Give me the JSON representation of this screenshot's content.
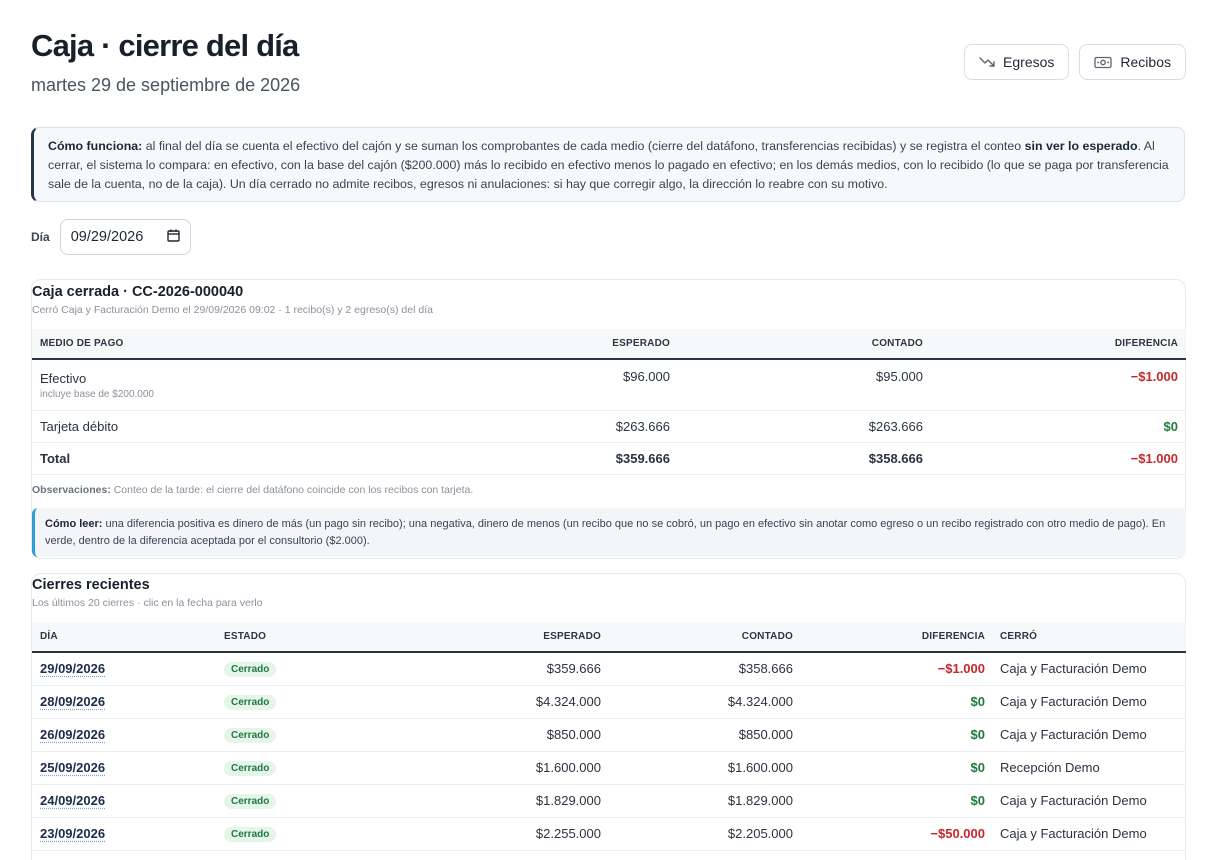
{
  "header": {
    "title": "Caja · cierre del día",
    "subtitle": "martes 29 de septiembre de 2026"
  },
  "actions": {
    "egresos_label": "Egresos",
    "recibos_label": "Recibos"
  },
  "info": {
    "lead": "Cómo funciona:",
    "text1": " al final del día se cuenta el efectivo del cajón y se suman los comprobantes de cada medio (cierre del datáfono, transferencias recibidas) y se registra el conteo ",
    "strong": "sin ver lo esperado",
    "text2": ". Al cerrar, el sistema lo compara: en efectivo, con la base del cajón ($200.000) más lo recibido en efectivo menos lo pagado en efectivo; en los demás medios, con lo recibido (lo que se paga por transferencia sale de la cuenta, no de la caja). Un día cerrado no admite recibos, egresos ni anulaciones: si hay que corregir algo, la dirección lo reabre con su motivo."
  },
  "day": {
    "label": "Día",
    "value": "09/29/2026"
  },
  "closure": {
    "title": "Caja cerrada · CC-2026-000040",
    "subtitle": "Cerró Caja y Facturación Demo el 29/09/2026 09:02 · 1 recibo(s) y 2 egreso(s) del día",
    "headers": {
      "medio": "MEDIO DE PAGO",
      "esperado": "ESPERADO",
      "contado": "CONTADO",
      "diferencia": "DIFERENCIA"
    },
    "rows": [
      {
        "medio": "Efectivo",
        "note": "incluye base de $200.000",
        "esperado": "$96.000",
        "contado": "$95.000",
        "diferencia": "−$1.000"
      },
      {
        "medio": "Tarjeta débito",
        "esperado": "$263.666",
        "contado": "$263.666",
        "diferencia": "$0"
      }
    ],
    "total": {
      "label": "Total",
      "esperado": "$359.666",
      "contado": "$358.666",
      "diferencia": "−$1.000"
    },
    "obs_label": "Observaciones:",
    "obs_text": " Conteo de la tarde: el cierre del datáfono coincide con los recibos con tarjeta.",
    "hint_lead": "Cómo leer:",
    "hint_text": " una diferencia positiva es dinero de más (un pago sin recibo); una negativa, dinero de menos (un recibo que no se cobró, un pago en efectivo sin anotar como egreso o un recibo registrado con otro medio de pago). En verde, dentro de la diferencia aceptada por el consultorio ($2.000)."
  },
  "recent": {
    "title": "Cierres recientes",
    "subtitle": "Los últimos 20 cierres · clic en la fecha para verlo",
    "headers": {
      "dia": "DÍA",
      "estado": "ESTADO",
      "esperado": "ESPERADO",
      "contado": "CONTADO",
      "diferencia": "DIFERENCIA",
      "cerro": "CERRÓ"
    },
    "rows": [
      {
        "dia": "29/09/2026",
        "estado": "Cerrado",
        "esperado": "$359.666",
        "contado": "$358.666",
        "diferencia": "−$1.000",
        "cerro": "Caja y Facturación Demo"
      },
      {
        "dia": "28/09/2026",
        "estado": "Cerrado",
        "esperado": "$4.324.000",
        "contado": "$4.324.000",
        "diferencia": "$0",
        "cerro": "Caja y Facturación Demo"
      },
      {
        "dia": "26/09/2026",
        "estado": "Cerrado",
        "esperado": "$850.000",
        "contado": "$850.000",
        "diferencia": "$0",
        "cerro": "Caja y Facturación Demo"
      },
      {
        "dia": "25/09/2026",
        "estado": "Cerrado",
        "esperado": "$1.600.000",
        "contado": "$1.600.000",
        "diferencia": "$0",
        "cerro": "Recepción Demo"
      },
      {
        "dia": "24/09/2026",
        "estado": "Cerrado",
        "esperado": "$1.829.000",
        "contado": "$1.829.000",
        "diferencia": "$0",
        "cerro": "Caja y Facturación Demo"
      },
      {
        "dia": "23/09/2026",
        "estado": "Cerrado",
        "esperado": "$2.255.000",
        "contado": "$2.205.000",
        "diferencia": "−$50.000",
        "cerro": "Caja y Facturación Demo"
      }
    ]
  },
  "colors": {
    "positive": "#1f7a3f",
    "negative": "#c4282e",
    "accent_dark": "#24344f",
    "accent_blue": "#2c9ed8"
  }
}
